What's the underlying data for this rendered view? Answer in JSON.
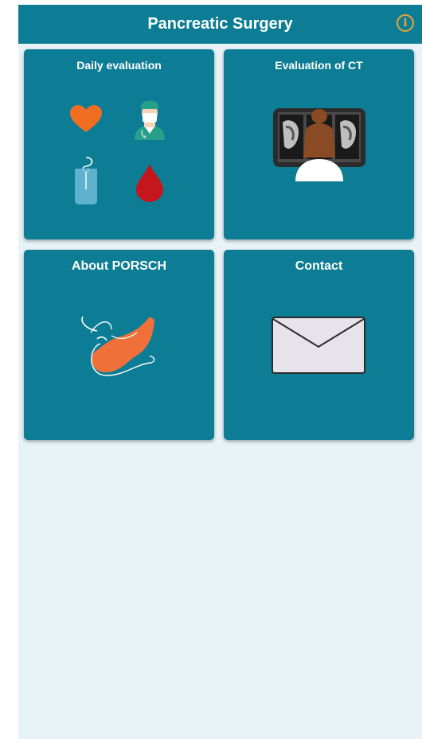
{
  "header": {
    "title": "Pancreatic Surgery",
    "info_icon": "info-icon",
    "accent": "#0d7d95",
    "info_color": "#e8a23b"
  },
  "tiles": [
    {
      "label": "Daily evaluation",
      "icons": [
        "heart-icon",
        "surgeon-icon",
        "drain-bag-icon",
        "blood-drop-icon"
      ]
    },
    {
      "label": "Evaluation of CT",
      "icons": [
        "ct-viewer-icon"
      ]
    },
    {
      "label": "About PORSCH",
      "icons": [
        "pancreas-icon"
      ]
    },
    {
      "label": "Contact",
      "icons": [
        "envelope-icon"
      ]
    }
  ],
  "colors": {
    "background": "#e8f3f7",
    "tile": "#0d7d95",
    "heart": "#f06d22",
    "blood": "#c4161c"
  }
}
